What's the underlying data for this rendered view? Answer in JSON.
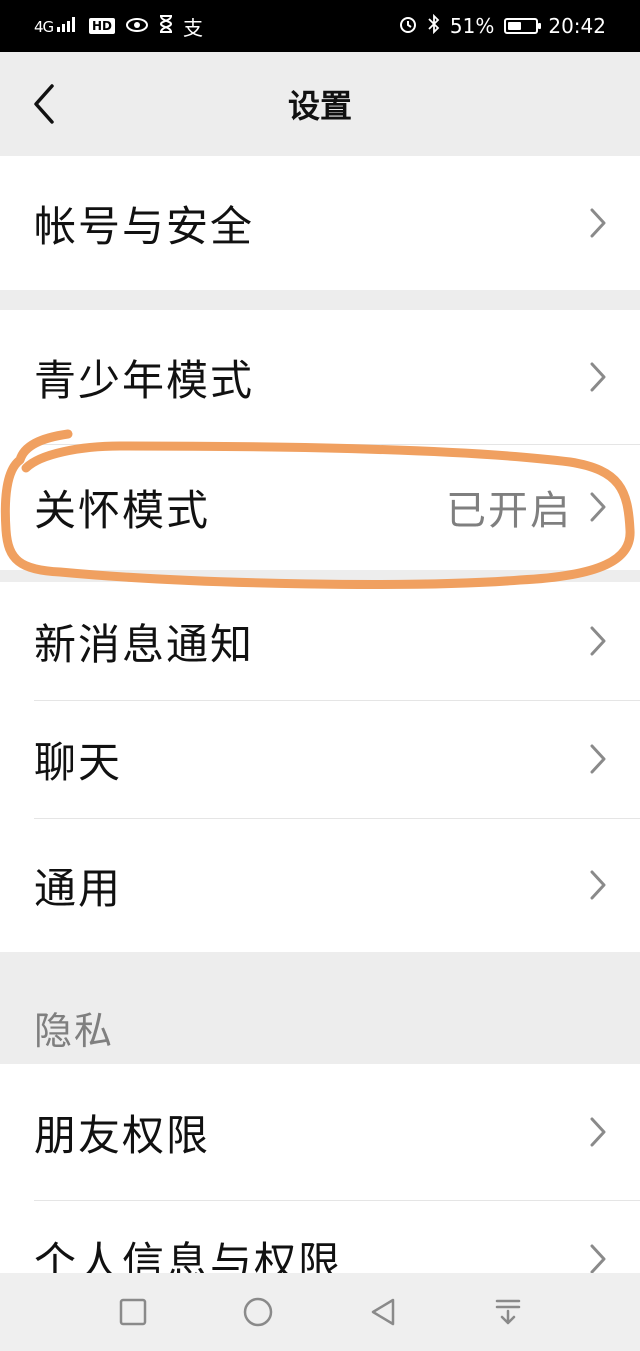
{
  "status": {
    "signal": "4G",
    "hd": "HD",
    "app_glyph": "支",
    "battery_text": "51%",
    "battery_level": 0.51,
    "time": "20:42"
  },
  "nav": {
    "title": "设置"
  },
  "groups": {
    "account": {
      "label": "帐号与安全"
    },
    "mode": {
      "youth": {
        "label": "青少年模式"
      },
      "care": {
        "label": "关怀模式",
        "value": "已开启"
      }
    },
    "main": {
      "notify": {
        "label": "新消息通知"
      },
      "chat": {
        "label": "聊天"
      },
      "general": {
        "label": "通用"
      }
    },
    "privacy": {
      "header": "隐私",
      "friends": {
        "label": "朋友权限"
      },
      "personal": {
        "label": "个人信息与权限"
      }
    }
  },
  "colors": {
    "annotation": "#f0a060",
    "background": "#ededed"
  }
}
